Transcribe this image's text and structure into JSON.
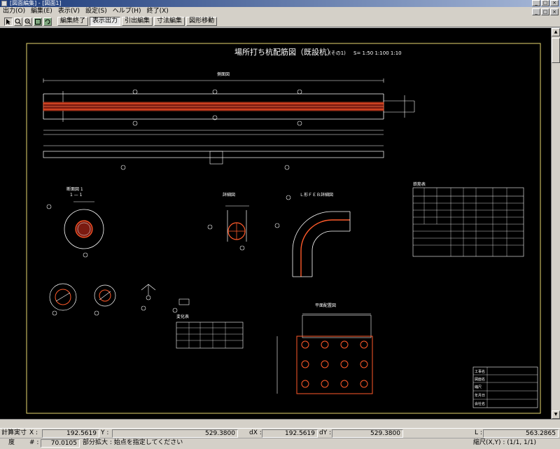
{
  "window": {
    "title": "[図面編集] - [図面1]"
  },
  "menu": {
    "items": [
      "出力(O)",
      "編集(E)",
      "表示(V)",
      "設定(S)",
      "ヘルプ(H)",
      "終了(X)"
    ]
  },
  "toolbar": {
    "buttons": [
      "編集終了",
      "表示出力",
      "引出編集",
      "寸法編集",
      "図形移動"
    ]
  },
  "drawing": {
    "title": "場所打ち杭配筋図（既設杭）",
    "sheet_info": "(その1)",
    "scale": "S= 1:50 1:100 1:10",
    "labels": {
      "main_view": "側面図",
      "section_view": "断面図 1",
      "section_sub": "1 — 1",
      "detail_view": "詳細図",
      "bend_view": "Ｌ形ＦＥＢ詳細図",
      "quantity_table": "鉄筋表",
      "spacer_table": "変化表",
      "plan_view": "平面配置図"
    },
    "title_block": [
      "工事名",
      "図面名",
      "縮尺",
      "年月日",
      "会社名"
    ]
  },
  "status": {
    "mode": "計算実寸",
    "x_label": "X :",
    "x_value": "192.5619",
    "y_label": "Y :",
    "y_value": "529.3800",
    "dx_label": "dX :",
    "dx_value": "192.5619",
    "dy_label": "dY :",
    "dy_value": "529.3800",
    "l_label": "L :",
    "l_value": "563.2865",
    "angle_label": "度",
    "angle_field_label": "# :",
    "angle_value": "70.0105",
    "message": "部分拡大 : 始点を指定してください",
    "scale_info": "縮尺(X,Y) : (1/1, 1/1)"
  },
  "colors": {
    "canvas_bg": "#000000",
    "rebar": "#ff5a2a",
    "line": "#ffffff",
    "frame": "#e8d870",
    "window_chrome": "#d4d0c8",
    "titlebar": "#1b3a7a"
  }
}
